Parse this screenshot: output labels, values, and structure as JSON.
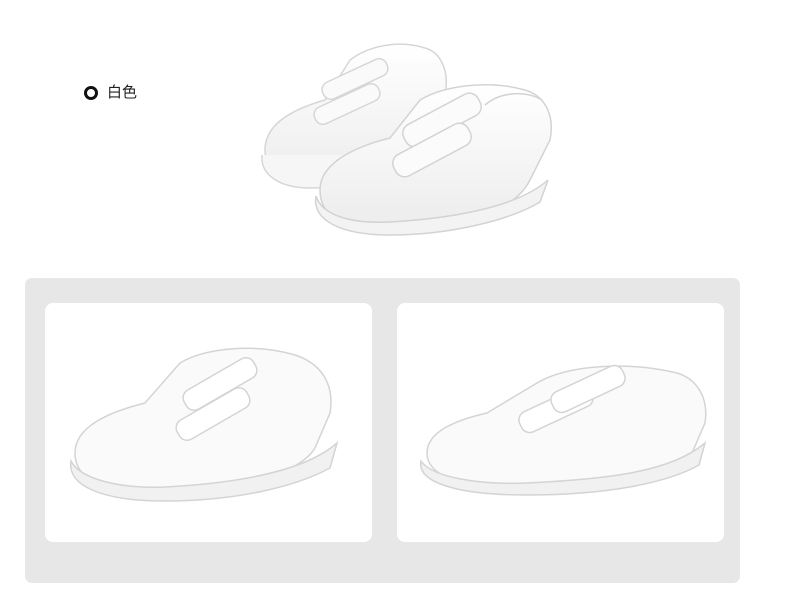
{
  "product": {
    "color_option": {
      "label": "白色",
      "icon": "ring-icon"
    }
  },
  "colors": {
    "panel_bg": "#e7e7e7",
    "card_bg": "#ffffff",
    "ring": "#111111"
  }
}
